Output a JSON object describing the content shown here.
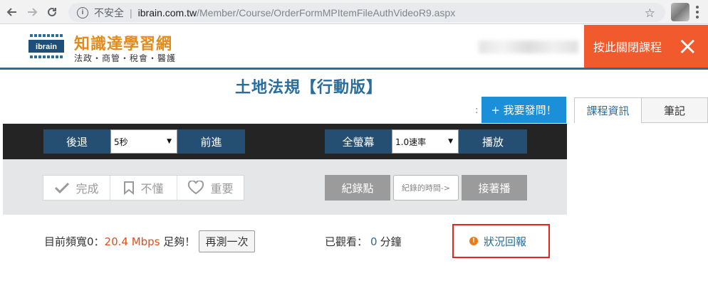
{
  "browser": {
    "security_label": "不安全",
    "separator": "|",
    "url_host": "ibrain.com.tw",
    "url_path": "/Member/Course/OrderFormMPItemFileAuthVideoR9.aspx"
  },
  "site": {
    "logo_mark_text": "ibrain",
    "logo_title": "知識達學習網",
    "logo_subtitle": "法政・商管・稅會・醫護",
    "close_course_label": "按此關閉課程",
    "close_icon": "×"
  },
  "course": {
    "title": "土地法規【行動版】"
  },
  "question": {
    "ask_label": "+ 我要發問！",
    "ask_prefix": ":"
  },
  "tabs": [
    {
      "label": "課程資訊",
      "active": true
    },
    {
      "label": "筆記",
      "active": false
    }
  ],
  "controls": {
    "back_label": "後退",
    "step_value": "5秒",
    "forward_label": "前進",
    "fullscreen_label": "全螢幕",
    "speed_value": "1.0速率",
    "play_label": "播放"
  },
  "marks": {
    "done_label": "完成",
    "confused_label": "不懂",
    "important_label": "重要",
    "bookmark_label": "紀錄點",
    "time_placeholder": "紀錄的時間->",
    "resume_label": "接著播"
  },
  "status": {
    "bandwidth_prefix": "目前頻寬0：",
    "bandwidth_value": "20.4 Mbps",
    "bandwidth_suffix": "足夠！",
    "retest_label": "再測一次",
    "watched_prefix": "已觀看：",
    "watched_value": "0",
    "watched_unit": "分鐘",
    "report_icon": "!",
    "report_label": "狀況回報"
  },
  "colors": {
    "accent_blue": "#1b8fd8",
    "dark_blue": "#244f72",
    "close_orange": "#f15a2c",
    "report_border": "#e8251b",
    "bandwidth_red": "#e04e1b"
  }
}
